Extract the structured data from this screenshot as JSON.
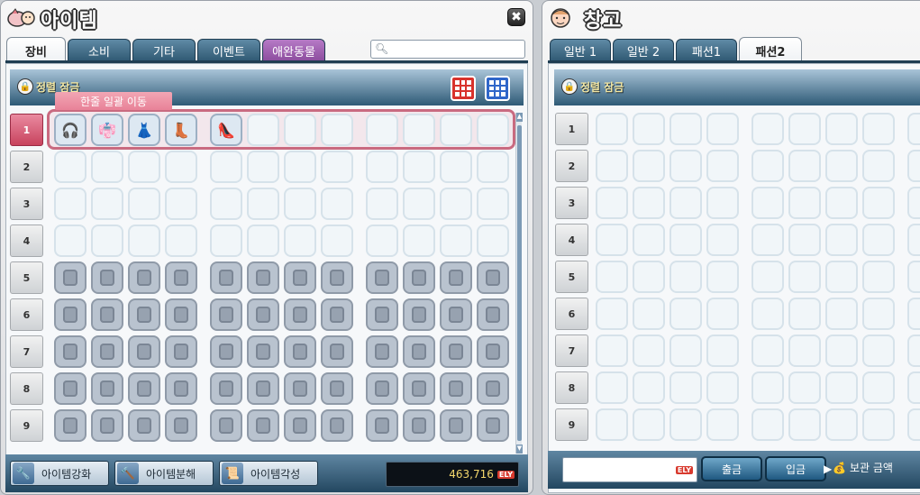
{
  "inventory": {
    "title": "아이템",
    "icon": "maple-character-icon",
    "close_label": "✖",
    "tabs": [
      {
        "label": "장비",
        "active": true
      },
      {
        "label": "소비",
        "active": false
      },
      {
        "label": "기타",
        "active": false
      },
      {
        "label": "이벤트",
        "active": false
      },
      {
        "label": "애완동물",
        "active": false
      }
    ],
    "search": {
      "placeholder": ""
    },
    "lock_sort_label": "정렬 잠금",
    "lock_glyph": "🔒",
    "tooltip": "한줄 일괄 이동",
    "row_numbers": [
      "1",
      "2",
      "3",
      "4",
      "5",
      "6",
      "7",
      "8",
      "9"
    ],
    "items": [
      {
        "name": "headphones-icon",
        "glyph": "🎧"
      },
      {
        "name": "robe-icon",
        "glyph": "👘"
      },
      {
        "name": "skirt-icon",
        "glyph": "👗"
      },
      {
        "name": "boots-icon",
        "glyph": "👢"
      },
      {
        "name": "shoes-icon",
        "glyph": "👠"
      }
    ],
    "footer": {
      "enhance_label": "아이템강화",
      "disassemble_label": "아이템분해",
      "awaken_label": "아이템각성",
      "meso": "463,716",
      "meso_unit": "ELY"
    },
    "colors": {
      "accent": "#2e5a76",
      "selection": "#c96a80"
    }
  },
  "storage": {
    "title": "창고",
    "icon": "shopkeeper-face-icon",
    "tabs": [
      {
        "label": "일반 1",
        "active": false
      },
      {
        "label": "일반 2",
        "active": false
      },
      {
        "label": "패션1",
        "active": false
      },
      {
        "label": "패션2",
        "active": true
      }
    ],
    "lock_sort_label": "정렬 잠금",
    "lock_glyph": "🔒",
    "row_numbers": [
      "1",
      "2",
      "3",
      "4",
      "5",
      "6",
      "7",
      "8",
      "9"
    ],
    "footer": {
      "input_unit": "ELY",
      "withdraw_label": "출금",
      "deposit_label": "입금",
      "storage_amount_label": "보관 금액"
    }
  }
}
